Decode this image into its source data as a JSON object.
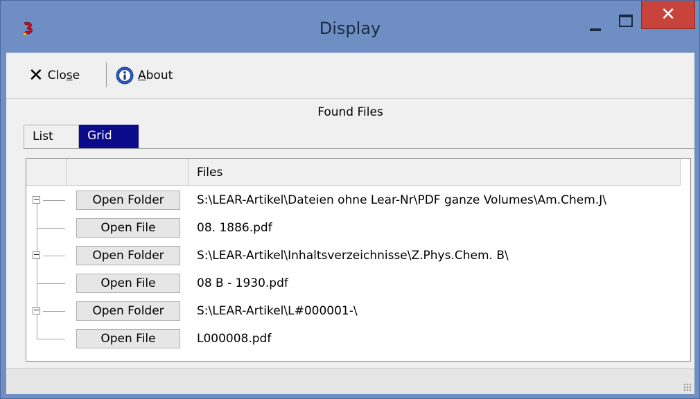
{
  "window": {
    "title": "Display",
    "icons": {
      "app": "app-icon",
      "minimize": "minimize-icon",
      "maximize": "maximize-icon",
      "close": "close-icon"
    },
    "close_glyph": "✕"
  },
  "toolbar": {
    "close_label_pre": "Clo",
    "close_label_u": "s",
    "close_label_post": "e",
    "close_glyph": "✕",
    "about_label_u": "A",
    "about_label_post": "bout"
  },
  "section_title": "Found Files",
  "tabs": [
    {
      "label": "List",
      "active": false
    },
    {
      "label": "Grid",
      "active": true
    }
  ],
  "grid": {
    "header": {
      "files": "Files"
    },
    "rows": [
      {
        "kind": "folder",
        "button": "Open Folder",
        "text": "S:\\LEAR-Artikel\\Dateien ohne Lear-Nr\\PDF ganze Volumes\\Am.Chem.J\\"
      },
      {
        "kind": "file",
        "button": "Open File",
        "text": "08. 1886.pdf"
      },
      {
        "kind": "folder",
        "button": "Open Folder",
        "text": "S:\\LEAR-Artikel\\Inhaltsverzeichnisse\\Z.Phys.Chem. B\\"
      },
      {
        "kind": "file",
        "button": "Open File",
        "text": "08 B - 1930.pdf"
      },
      {
        "kind": "folder",
        "button": "Open Folder",
        "text": "S:\\LEAR-Artikel\\L#000001-\\"
      },
      {
        "kind": "file",
        "button": "Open File",
        "text": "L000008.pdf"
      }
    ]
  },
  "colors": {
    "titlebar": "#6f8fc4",
    "close_button": "#c8433b",
    "active_tab": "#0a0a8a"
  }
}
